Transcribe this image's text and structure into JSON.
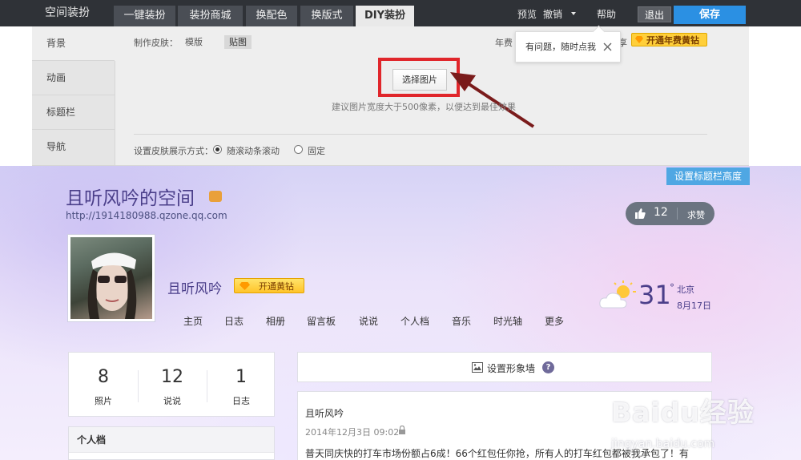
{
  "topbar": {
    "brand": "空间装扮",
    "tabs": [
      {
        "label": "一键装扮"
      },
      {
        "label": "装扮商城"
      },
      {
        "label": "换配色"
      },
      {
        "label": "换版式"
      },
      {
        "label": "DIY装扮"
      }
    ],
    "active_tab": "DIY装扮",
    "preview": "预览",
    "undo": "撤销",
    "help": "帮助",
    "exit": "退出",
    "save": "保存"
  },
  "editor": {
    "sidebar": [
      {
        "label": "背景"
      },
      {
        "label": "动画"
      },
      {
        "label": "标题栏"
      },
      {
        "label": "导航"
      }
    ],
    "skin_label": "制作皮肤：",
    "skin_options": [
      {
        "label": "模版"
      },
      {
        "label": "贴图"
      }
    ],
    "upload_button": "选择图片",
    "hint": "建议图片宽度大于500像素，以便达到最佳效果",
    "display_label": "设置皮肤展示方式：",
    "display_options": [
      {
        "label": "随滚动条滚动",
        "checked": true
      },
      {
        "label": "固定",
        "checked": false
      }
    ],
    "yearly_prefix": "年费",
    "yearly_suffix": "享",
    "vip_yearly_button": "开通年费黄钻",
    "tooltip": "有问题，随时点我"
  },
  "profile": {
    "set_title_height": "设置标题栏高度",
    "space_title": "且听风吟的空间",
    "space_url": "http://1914180988.qzone.qq.com",
    "likes": "12",
    "like_action": "求赞",
    "nickname": "且听风吟",
    "vip_button": "开通黄钻",
    "nav": [
      {
        "label": "主页"
      },
      {
        "label": "日志"
      },
      {
        "label": "相册"
      },
      {
        "label": "留言板"
      },
      {
        "label": "说说"
      },
      {
        "label": "个人档"
      },
      {
        "label": "音乐"
      },
      {
        "label": "时光轴"
      },
      {
        "label": "更多"
      }
    ],
    "weather": {
      "temp": "31",
      "deg": "°",
      "city": "北京",
      "date": "8月17日"
    },
    "stats": [
      {
        "num": "8",
        "label": "照片"
      },
      {
        "num": "12",
        "label": "说说"
      },
      {
        "num": "1",
        "label": "日志"
      }
    ],
    "profile_card_title": "个人档",
    "wall_button": "设置形象墙",
    "post": {
      "author": "且听风吟",
      "time": "2014年12月3日 09:02",
      "text": "普天同庆快的打车市场份额占6成！66个红包任你抢，所有人的打车红包都被我承包了！有"
    }
  },
  "watermark": {
    "text": "Baidu经验",
    "url": "jingyan.baidu.com"
  },
  "colors": {
    "topbar": "#2f3237",
    "save": "#2b90e3",
    "highlight": "#e0262b",
    "vip": "#ffcf3a",
    "title": "#4b3f8a"
  }
}
